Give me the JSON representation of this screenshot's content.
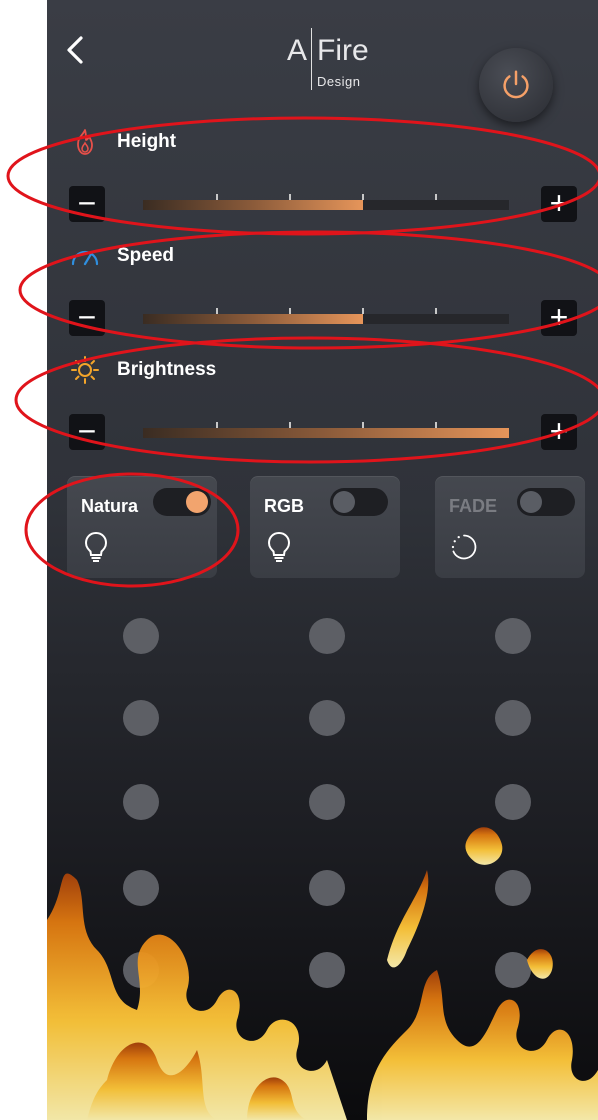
{
  "header": {
    "logo_a": "A",
    "logo_fire": "Fire",
    "logo_design": "Design"
  },
  "controls": {
    "height": {
      "label": "Height",
      "minus": "−",
      "plus": "+",
      "level": 0.6
    },
    "speed": {
      "label": "Speed",
      "minus": "−",
      "plus": "+",
      "level": 0.6
    },
    "brightness": {
      "label": "Brightness",
      "minus": "−",
      "plus": "+",
      "level": 1.0
    }
  },
  "modes": [
    {
      "label": "Natura",
      "on": true
    },
    {
      "label": "RGB",
      "on": false
    },
    {
      "label": "FADE",
      "on": false
    }
  ],
  "colors": {
    "accent": "#f2a46e",
    "annotation": "#e0141b",
    "height_icon": "#e8504a",
    "speed_icon": "#2f8fe0",
    "brightness_icon": "#f4a52a"
  },
  "icons": [
    "back-chevron-icon",
    "power-icon",
    "flame-icon",
    "speedometer-icon",
    "sun-icon",
    "lightbulb-icon",
    "spinner-icon"
  ]
}
